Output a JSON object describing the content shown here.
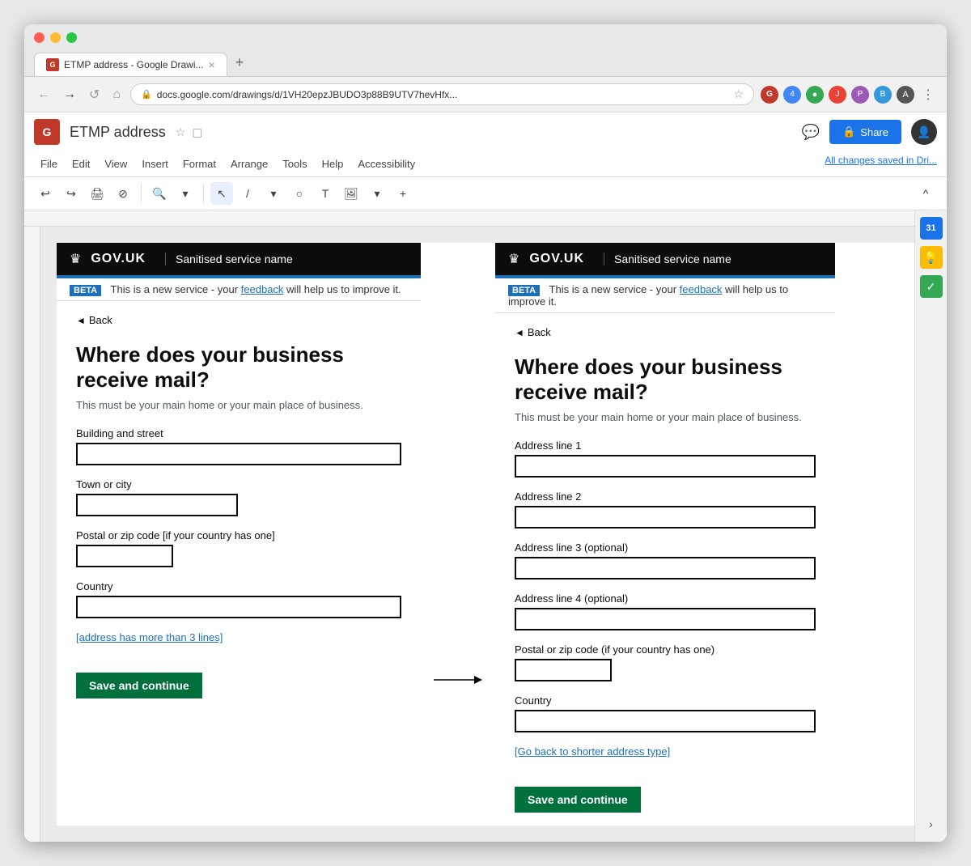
{
  "browser": {
    "tab_title": "ETMP address - Google Drawi...",
    "tab_close": "×",
    "new_tab": "+",
    "nav_back": "←",
    "nav_forward": "→",
    "nav_reload": "↺",
    "nav_home": "⌂",
    "address": "docs.google.com/drawings/d/1VH20epzJBUDO3p88B9UTV7hevHfx...",
    "bookmark": "☆",
    "collapse": "^"
  },
  "app": {
    "logo_letter": "G",
    "title": "ETMP address",
    "star_icon": "☆",
    "folder_icon": "▢",
    "comment_icon": "💬",
    "share_label": "Share",
    "autosave_text": "All changes saved in Dri...",
    "menu_items": [
      "File",
      "Edit",
      "View",
      "Insert",
      "Format",
      "Arrange",
      "Tools",
      "Help",
      "Accessibility"
    ],
    "avatar_initials": "A"
  },
  "drawing_toolbar": {
    "undo": "↩",
    "redo": "↪",
    "print": "🖨",
    "paint_format": "⊘",
    "zoom": "🔍",
    "zoom_label": "▾",
    "select": "↖",
    "line": "/",
    "shapes": "○",
    "text": "T",
    "image": "🖼",
    "more": "+"
  },
  "panel_left": {
    "header_crown": "♛",
    "header_logo": "GOV.UK",
    "header_service": "Sanitised service name",
    "beta_tag": "BETA",
    "beta_text": "This is a new service - your",
    "beta_link": "feedback",
    "beta_suffix": "will help us to improve it.",
    "back_label": "◄ Back",
    "heading": "Where does your business receive mail?",
    "hint": "This must be your main home or your main place of business.",
    "field1_label": "Building and street",
    "field1_placeholder": "",
    "field2_label": "Town or city",
    "field2_placeholder": "",
    "field3_label": "Postal or zip code  [if your country has one]",
    "field3_placeholder": "",
    "field4_label": "Country",
    "field4_placeholder": "",
    "expand_link": "[address has more than 3 lines]",
    "save_label": "Save and continue"
  },
  "panel_right": {
    "header_crown": "♛",
    "header_logo": "GOV.UK",
    "header_service": "Sanitised service name",
    "beta_tag": "BETA",
    "beta_text": "This is a new service - your",
    "beta_link": "feedback",
    "beta_suffix": "will help us to improve it.",
    "back_label": "◄ Back",
    "heading": "Where does your business receive mail?",
    "hint": "This must be your main home or your main place of business.",
    "field1_label": "Address line 1",
    "field2_label": "Address line 2",
    "field3_label": "Address line 3 (optional)",
    "field4_label": "Address line 4  (optional)",
    "field5_label": "Postal or zip code  (if your country has one)",
    "field6_label": "Country",
    "collapse_link": "[Go back to shorter address type]",
    "save_label": "Save and continue"
  },
  "right_sidebar": {
    "calendar_label": "31",
    "bulb_icon": "💡",
    "check_icon": "✓",
    "chevron_right": "›"
  }
}
